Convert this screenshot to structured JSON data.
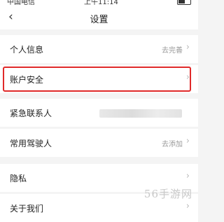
{
  "status_bar": {
    "carrier": "中国电信",
    "time": "上午11:14"
  },
  "nav": {
    "back_icon": "chevron-left-icon",
    "title": "设置"
  },
  "rows": [
    {
      "label": "个人信息",
      "value": "去完善"
    },
    {
      "label": "账户安全",
      "value": ""
    },
    {
      "label": "紧急联系人",
      "value": ""
    },
    {
      "label": "常用驾驶人",
      "value": "去添加"
    },
    {
      "label": "隐私",
      "value": ""
    },
    {
      "label": "关于我们",
      "value": ""
    }
  ],
  "highlight_color": "#e02a2a",
  "watermark": "56手游网"
}
